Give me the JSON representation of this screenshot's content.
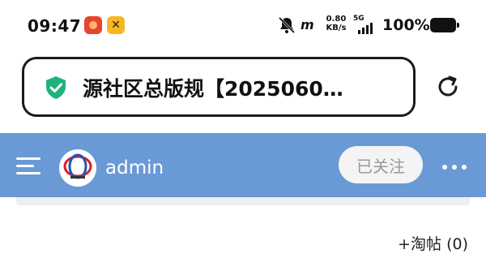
{
  "status_bar": {
    "time": "09:47",
    "hd_badge": "m",
    "net_speed_value": "0.80",
    "net_speed_unit": "KB/s",
    "signal_label": "5G",
    "battery_percent": "100%",
    "app_icons": [
      "red-app-icon",
      "yellow-tool-app-icon"
    ],
    "icons": [
      "bell-off-icon",
      "signal-icon",
      "battery-icon"
    ]
  },
  "address_bar": {
    "title": "源社区总版规【2025060…",
    "secure": true,
    "accent_color": "#1fb37a"
  },
  "header": {
    "username": "admin",
    "follow_label": "已关注",
    "background_color": "#6a9ad6"
  },
  "footer": {
    "favorite_label": "+淘帖 (0)"
  }
}
